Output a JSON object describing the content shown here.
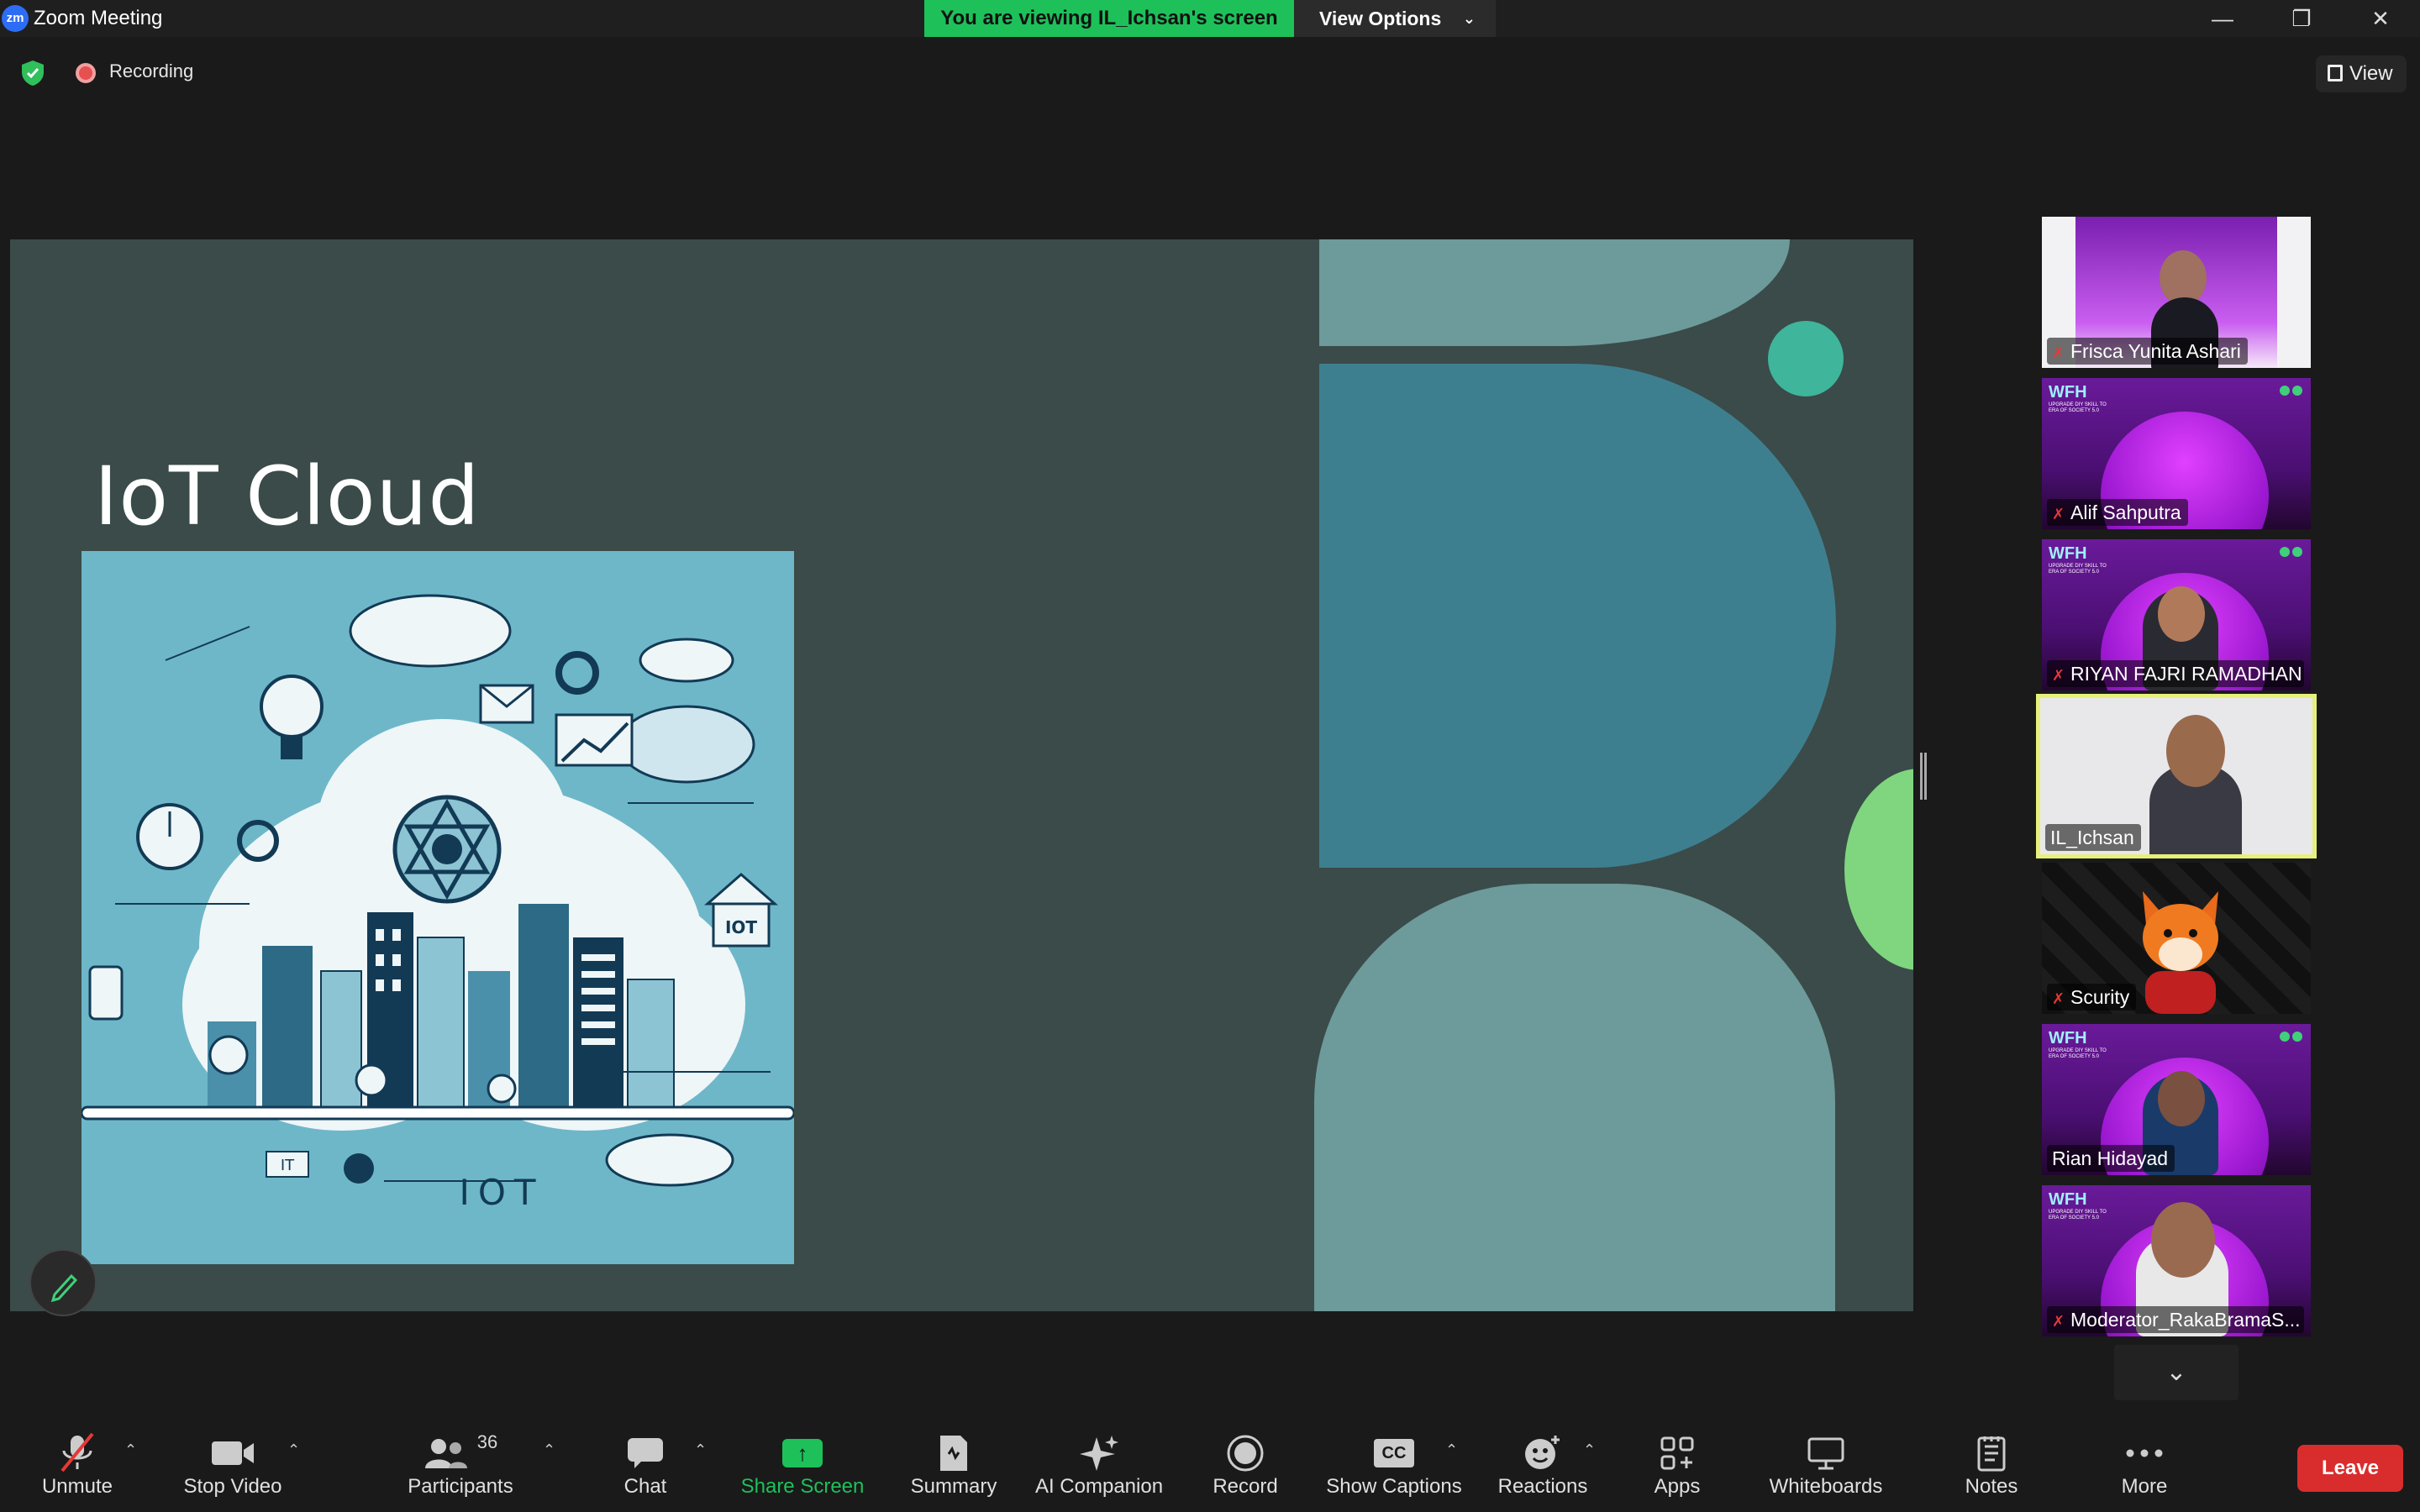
{
  "window": {
    "title": "Zoom Meeting",
    "logo_text": "zm",
    "viewing_banner": "You are viewing IL_Ichsan's screen",
    "view_options": "View Options",
    "minimize": "—",
    "restore": "❐",
    "close": "✕"
  },
  "status": {
    "recording_label": "Recording",
    "view_label": "View"
  },
  "slide": {
    "title": "IoT Cloud",
    "image_label_iot_house": "IOT",
    "image_label_bottom": "IOT",
    "image_label_it": "IT"
  },
  "gallery": {
    "participants": [
      {
        "name": "Frisca Yunita Ashari",
        "muted": true
      },
      {
        "name": "Alif Sahputra",
        "muted": true
      },
      {
        "name": "RIYAN FAJRI RAMADHAN",
        "muted": true
      },
      {
        "name": "IL_Ichsan",
        "muted": false,
        "active": true
      },
      {
        "name": "Scurity",
        "muted": true
      },
      {
        "name": "Rian Hidayad",
        "muted": false
      },
      {
        "name": "Moderator_RakaBramaS...",
        "muted": true
      }
    ],
    "scroll_icon": "⌄",
    "banner_text": "WFH",
    "banner_sub": "UPGRADE DIY SKILL TO ERA OF SOCIETY 5.0"
  },
  "toolbar": {
    "unmute": "Unmute",
    "stop_video": "Stop Video",
    "participants": "Participants",
    "participants_count": "36",
    "chat": "Chat",
    "share_screen": "Share Screen",
    "summary": "Summary",
    "ai_companion": "AI Companion",
    "record": "Record",
    "show_captions": "Show Captions",
    "reactions": "Reactions",
    "apps": "Apps",
    "whiteboards": "Whiteboards",
    "notes": "Notes",
    "more": "More",
    "leave": "Leave",
    "captions_icon_text": "CC"
  },
  "colors": {
    "accent_green": "#1ec05a",
    "leave_red": "#d92d2d",
    "slide_bg": "#3a4b49"
  }
}
